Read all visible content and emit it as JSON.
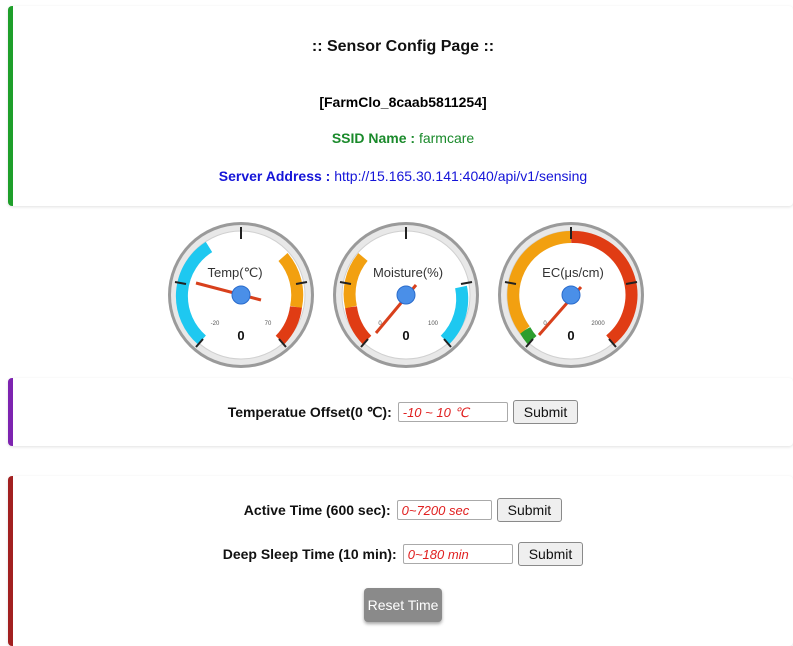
{
  "header": {
    "title": ":: Sensor Config Page ::",
    "device_id": "[FarmClo_8caab5811254]",
    "ssid_label": "SSID Name :",
    "ssid_value": "farmcare",
    "server_label": "Server Address :",
    "server_value": "http://15.165.30.141:4040/api/v1/sensing"
  },
  "gauges": [
    {
      "label": "Temp(℃)",
      "min_label": "-20",
      "max_label": "70",
      "value": "0"
    },
    {
      "label": "Moisture(%)",
      "min_label": "0",
      "max_label": "100",
      "value": "0"
    },
    {
      "label": "EC(μs/cm)",
      "min_label": "0",
      "max_label": "2000",
      "value": "0"
    }
  ],
  "offset": {
    "label": "Temperatue Offset(0 ℃):",
    "placeholder": "-10 ~ 10 ℃",
    "submit": "Submit"
  },
  "time": {
    "active_label": "Active Time (600 sec):",
    "active_placeholder": "0~7200 sec",
    "active_submit": "Submit",
    "sleep_label": "Deep Sleep Time (10 min):",
    "sleep_placeholder": "0~180 min",
    "sleep_submit": "Submit",
    "reset": "Reset Time"
  },
  "colors": {
    "info_border": "#1e9f2a",
    "offset_border": "#7d23b0",
    "time_border": "#a22020",
    "ssid": "#1a8a2b",
    "server": "#1414d8"
  }
}
